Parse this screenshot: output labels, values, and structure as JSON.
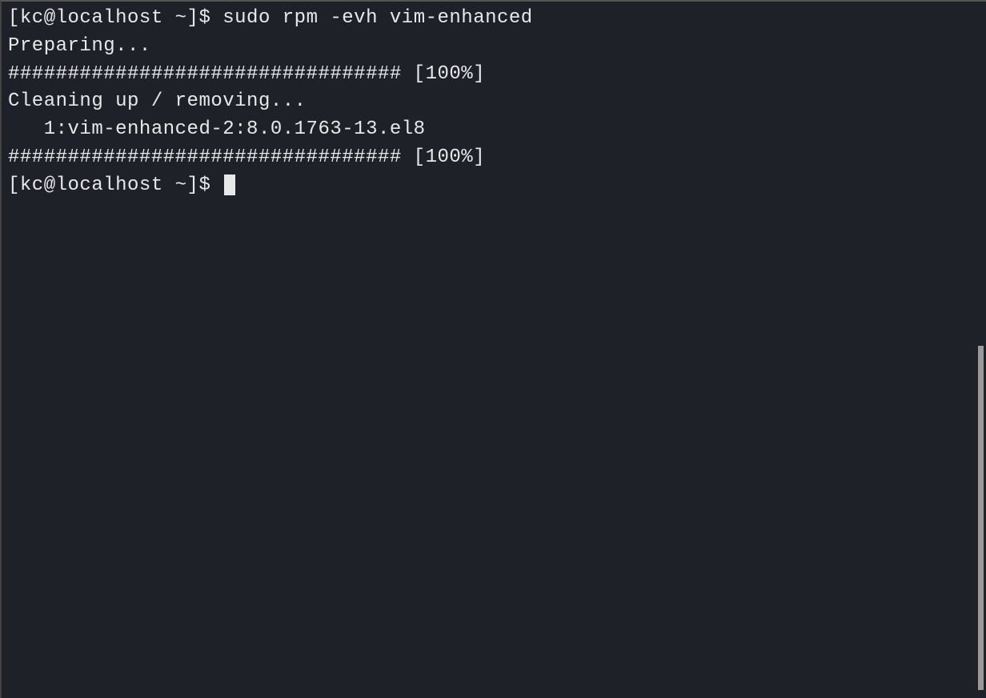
{
  "terminal": {
    "lines": [
      {
        "prompt": "[kc@localhost ~]$ ",
        "command": "sudo rpm -evh vim-enhanced"
      },
      {
        "text": "Preparing..."
      },
      {
        "text": "################################# [100%]"
      },
      {
        "text": "Cleaning up / removing..."
      },
      {
        "text": "   1:vim-enhanced-2:8.0.1763-13.el8"
      },
      {
        "text": "################################# [100%]"
      }
    ],
    "current_prompt": "[kc@localhost ~]$ "
  }
}
